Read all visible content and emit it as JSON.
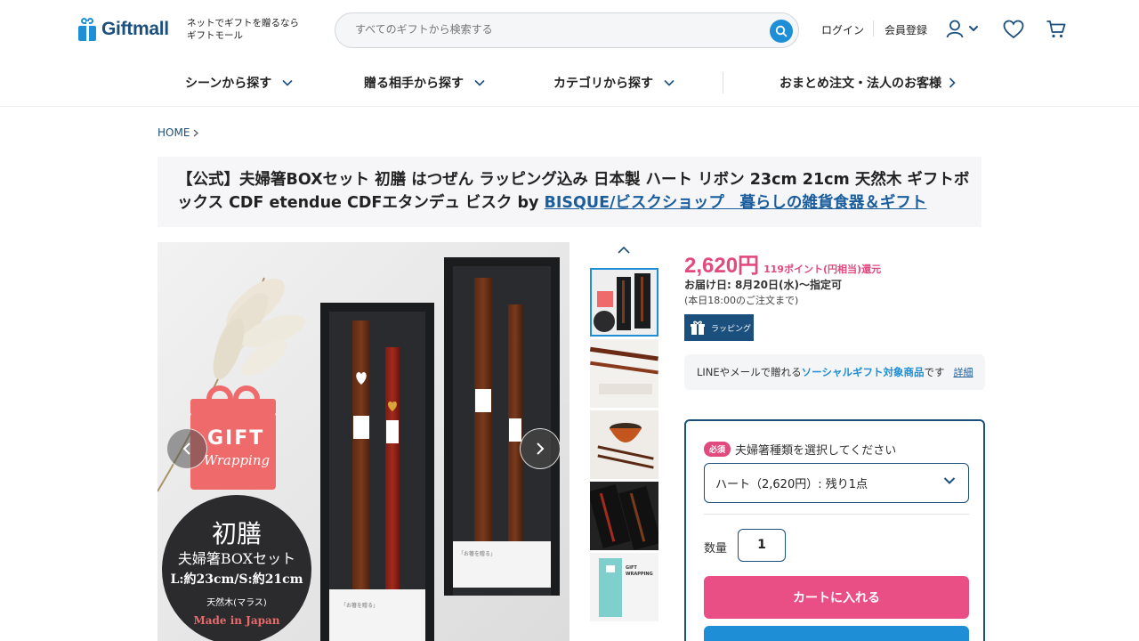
{
  "header": {
    "logo_text": "Giftmall",
    "tagline_line1": "ネットでギフトを贈るなら",
    "tagline_line2": "ギフトモール",
    "search_placeholder": "すべてのギフトから検索する",
    "login": "ログイン",
    "register": "会員登録",
    "icons": [
      "search-icon",
      "user-icon",
      "chevron-down-icon",
      "heart-icon",
      "cart-icon"
    ]
  },
  "nav": {
    "items": [
      {
        "label": "シーンから探す"
      },
      {
        "label": "贈る相手から探す"
      },
      {
        "label": "カテゴリから探す"
      },
      {
        "label": "おまとめ注文・法人のお客様"
      }
    ]
  },
  "breadcrumb": {
    "home": "HOME"
  },
  "product": {
    "title_text": "【公式】夫婦箸BOXセット 初膳 はつぜん ラッピング込み 日本製 ハート リボン 23cm 21cm 天然木 ギフトボックス CDF etendue CDFエタンデュ ビスク by",
    "shop_link": "BISQUE/ビスクショップ　暮らしの雑貨食器＆ギフト",
    "image": {
      "gift_label": "GIFT",
      "wrapping_label": "Wrapping",
      "badge_title": "初膳",
      "badge_sub": "夫婦箸BOXセット",
      "badge_size": "L:約23cm/S:約21cm",
      "badge_material": "天然木(マラス)",
      "badge_origin": "Made in Japan",
      "sleeve_text_1": "「お箸を贈る」",
      "sleeve_text_2": "「お箸を贈る」"
    },
    "thumb_gift_label": "GIFT WRAPPING",
    "price": "2,620円",
    "points": "119ポイント(円相当)還元",
    "delivery": "お届け日: 8月20日(水)〜指定可",
    "cutoff": "(本日18:00のご注文まで)",
    "wrapping_badge": "ラッピング",
    "social_prefix": "LINEやメールで贈れる",
    "social_highlight": "ソーシャルギフト対象商品",
    "social_suffix": "です",
    "social_detail": "詳細"
  },
  "order": {
    "required_badge": "必須",
    "select_label": "夫婦箸種類を選択してください",
    "select_value": "ハート（2,620円）: 残り1点",
    "qty_label": "数量",
    "qty_value": "1",
    "cart_button": "カートに入れる"
  },
  "colors": {
    "brand_blue": "#1e8fd6",
    "navy": "#1b4f7e",
    "price_pink": "#e24a7e"
  }
}
